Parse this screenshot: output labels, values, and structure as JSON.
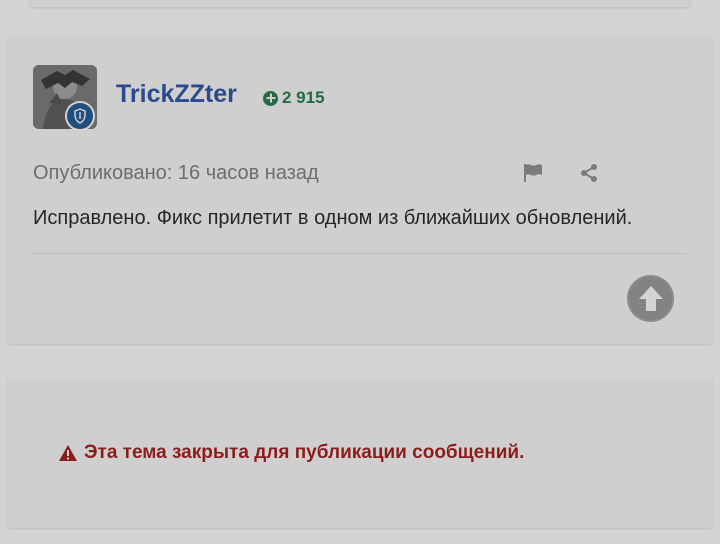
{
  "post": {
    "author": {
      "name": "TrickZZter",
      "reputation": "2 915"
    },
    "published": "Опубликовано: 16 часов назад",
    "text": "Исправлено. Фикс прилетит в одном из ближайших обновлений."
  },
  "topic": {
    "closed_notice": "Эта тема закрыта для публикации сообщений."
  },
  "colors": {
    "author_name": "#2b4a8c",
    "reputation": "#256b43",
    "closed_notice": "#8c1d1d",
    "badge": "#1f4e7f"
  },
  "icons": {
    "reputation": "plus-circle-icon",
    "badge": "shield-icon",
    "report": "flag-icon",
    "share": "share-icon",
    "scroll_top": "arrow-up-icon",
    "warning": "warning-icon"
  }
}
